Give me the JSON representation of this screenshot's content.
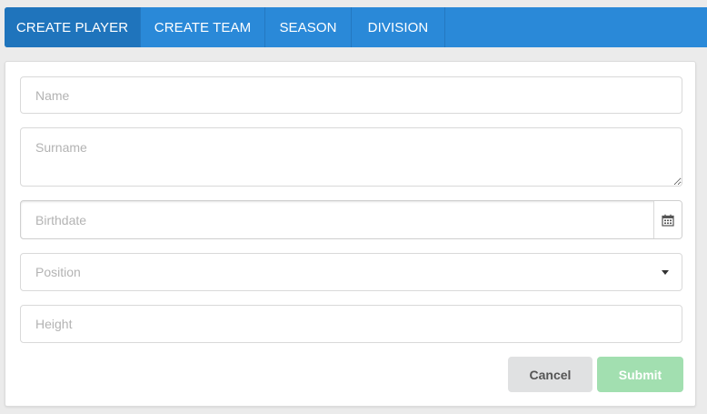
{
  "tabs": [
    {
      "label": "CREATE PLAYER",
      "active": true
    },
    {
      "label": "CREATE TEAM",
      "active": false
    },
    {
      "label": "SEASON",
      "active": false
    },
    {
      "label": "DIVISION",
      "active": false
    }
  ],
  "form": {
    "name": {
      "placeholder": "Name",
      "value": ""
    },
    "surname": {
      "placeholder": "Surname",
      "value": ""
    },
    "birthdate": {
      "placeholder": "Birthdate",
      "value": "",
      "icon": "calendar-icon"
    },
    "position": {
      "placeholder": "Position",
      "icon": "chevron-down-icon"
    },
    "height": {
      "placeholder": "Height",
      "value": ""
    }
  },
  "actions": {
    "cancel_label": "Cancel",
    "submit_label": "Submit"
  },
  "colors": {
    "tabbar": "#2a89d8",
    "tab_active": "#1f74bc",
    "cancel_bg": "#e0e1e2",
    "submit_bg": "#a2dfb0",
    "page_bg": "#ebebeb"
  }
}
